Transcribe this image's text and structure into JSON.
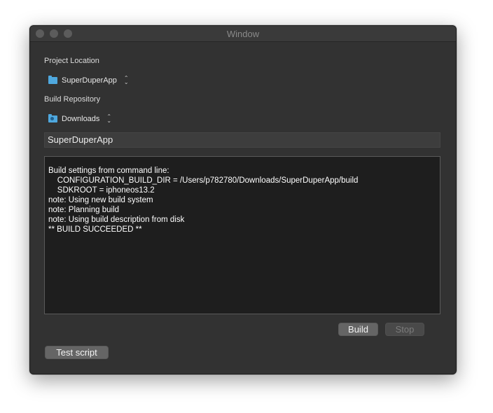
{
  "window": {
    "title": "Window"
  },
  "project_location": {
    "label": "Project Location",
    "selected": "SuperDuperApp",
    "icon": "folder-icon"
  },
  "build_repository": {
    "label": "Build Repository",
    "selected": "Downloads",
    "icon": "downloads-folder-icon"
  },
  "app_name_field": {
    "value": "SuperDuperApp"
  },
  "console": {
    "lines": [
      "Build settings from command line:",
      "    CONFIGURATION_BUILD_DIR = /Users/p782780/Downloads/SuperDuperApp/build",
      "    SDKROOT = iphoneos13.2",
      "",
      "",
      "note: Using new build system",
      "",
      "note: Planning build",
      "",
      "note: Using build description from disk",
      "",
      "",
      "** BUILD SUCCEEDED **"
    ]
  },
  "buttons": {
    "build": "Build",
    "stop": "Stop",
    "test_script": "Test script"
  },
  "colors": {
    "window_bg": "#323232",
    "console_bg": "#1e1e1e",
    "folder_accent": "#4fa8de"
  }
}
